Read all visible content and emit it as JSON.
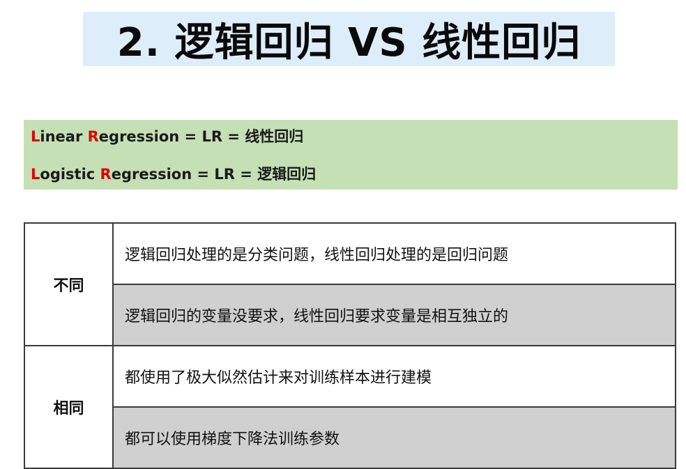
{
  "title": "2. 逻辑回归 VS 线性回归",
  "definitions": {
    "linear": {
      "first_letter": "L",
      "first_rest": "inear ",
      "second_letter": "R",
      "second_rest": "egression = LR = 线性回归"
    },
    "logistic": {
      "first_letter": "L",
      "first_rest": "ogistic ",
      "second_letter": "R",
      "second_rest": "egression = LR = 逻辑回归"
    }
  },
  "comparison": {
    "differences": {
      "label": "不同",
      "items": [
        "逻辑回归处理的是分类问题，线性回归处理的是回归问题",
        "逻辑回归的变量没要求，线性回归要求变量是相互独立的"
      ]
    },
    "similarities": {
      "label": "相同",
      "items": [
        "都使用了极大似然估计来对训练样本进行建模",
        "都可以使用梯度下降法训练参数"
      ]
    }
  },
  "colors": {
    "title_bg": "#ddeefa",
    "definitions_bg": "#c5e0b4",
    "highlight_letter": "#e00000",
    "shaded_row": "#d0d0d0",
    "border": "#3a3a3a"
  }
}
